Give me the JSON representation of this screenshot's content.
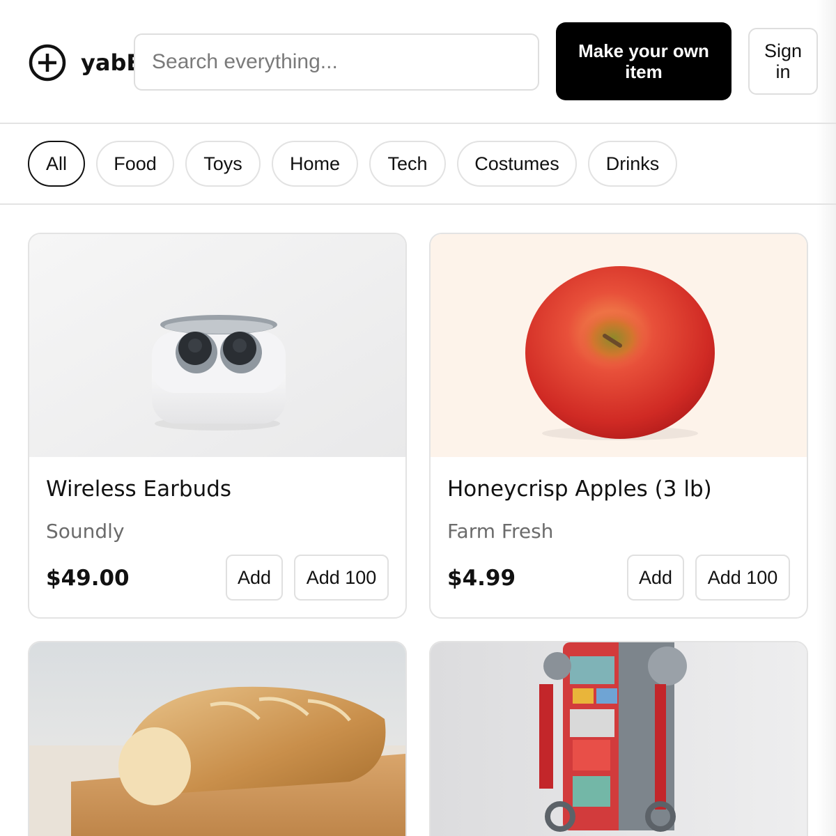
{
  "header": {
    "logo_icon": "plus-circle-icon",
    "logo_text": "yabE",
    "search_placeholder": "Search everything...",
    "make_button": "Make your own item",
    "signin_button": "Sign in"
  },
  "categories": [
    "All",
    "Food",
    "Toys",
    "Home",
    "Tech",
    "Costumes",
    "Drinks"
  ],
  "selected_category": "All",
  "products": [
    {
      "name": "Wireless Earbuds",
      "brand": "Soundly",
      "price": "$49.00",
      "add_label": "Add",
      "add100_label": "Add 100",
      "image": "earbuds-image"
    },
    {
      "name": "Honeycrisp Apples (3 lb)",
      "brand": "Farm Fresh",
      "price": "$4.99",
      "add_label": "Add",
      "add100_label": "Add 100",
      "image": "apple-image"
    },
    {
      "image": "bread-loaf-image"
    },
    {
      "image": "toy-robot-image"
    }
  ],
  "colors": {
    "primary_button": "#000000",
    "border": "#e3e3e3",
    "muted_text": "#6b6b6b"
  }
}
